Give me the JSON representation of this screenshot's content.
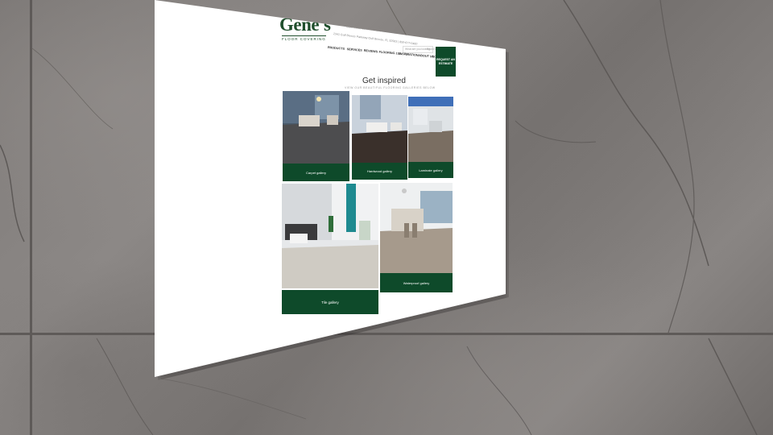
{
  "brand": {
    "name": "Gene's",
    "tagline": "FLOOR COVERING"
  },
  "header": {
    "address_lines": [
      "1821 Route 18 N Freehold, NJ 07728 | 732-308-1890",
      "2341 Gulf Breeze Parkway Gulf Breeze, FL 32563 | 850-677-0460"
    ],
    "search_placeholder": "What are you looking for?",
    "search_button": "Search",
    "nav": [
      "PRODUCTS",
      "SERVICES",
      "REVIEWS",
      "FLOORING 101",
      "INSPIRATION",
      "ABOUT US",
      "CONTACT"
    ],
    "cta_label": "REQUEST AN ESTIMATE"
  },
  "section": {
    "title": "Get inspired",
    "subtitle": "VIEW OUR BEAUTIFUL FLOORING GALLERIES BELOW"
  },
  "galleries": [
    {
      "label": "Carpet gallery"
    },
    {
      "label": "Hardwood gallery"
    },
    {
      "label": "Laminate gallery"
    },
    {
      "label": "Tile gallery"
    },
    {
      "label": "Waterproof gallery"
    }
  ],
  "colors": {
    "brand_green": "#0e4a2a",
    "panel": "#ffffff",
    "wall": "#7c7876"
  }
}
